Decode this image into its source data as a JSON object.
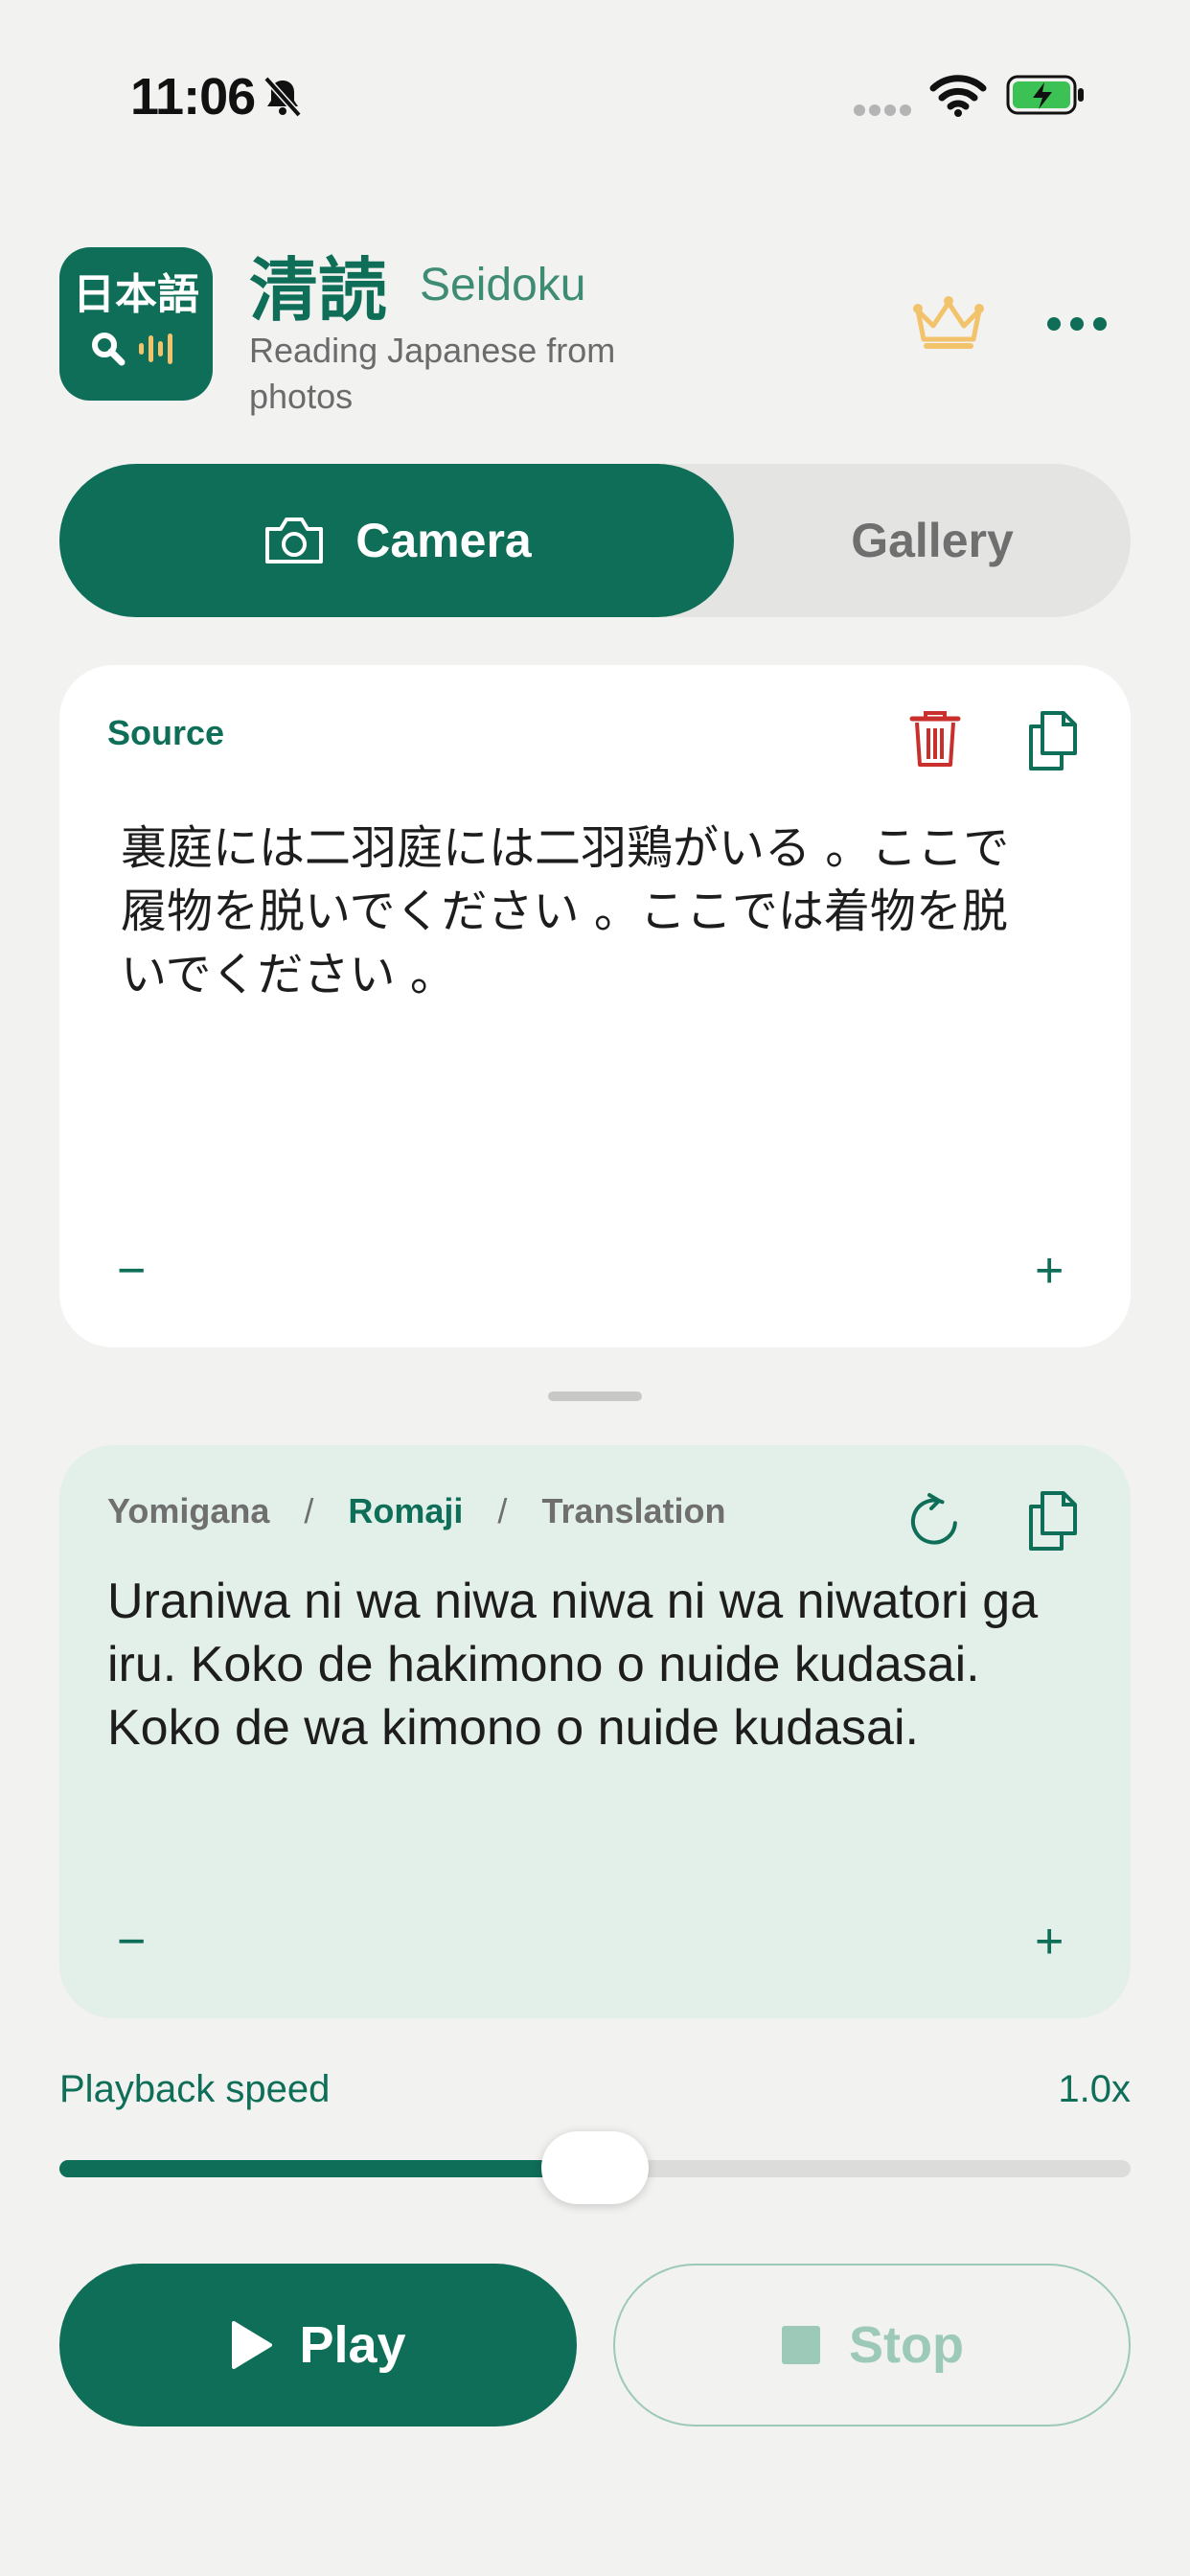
{
  "status_bar": {
    "time": "11:06"
  },
  "header": {
    "logo_text": "日本語",
    "title_kanji": "清読",
    "title_romaji": "Seidoku",
    "subtitle": "Reading Japanese from photos",
    "crown_icon": "crown-icon",
    "more_icon": "ellipsis-icon"
  },
  "segmented": {
    "camera_label": "Camera",
    "gallery_label": "Gallery",
    "selected": "Camera"
  },
  "source": {
    "label": "Source",
    "text": "裏庭には二羽庭には二羽鶏がいる 。ここで履物を脱いでください 。ここでは着物を脱いでください 。",
    "minus": "−",
    "plus": "+"
  },
  "output": {
    "tabs": [
      "Yomigana",
      "Romaji",
      "Translation"
    ],
    "separator": "/",
    "active_tab": "Romaji",
    "text": "Uraniwa ni wa niwa niwa ni wa niwatori ga iru. Koko de hakimono o nuide kudasai. Koko de wa kimono o nuide kudasai.",
    "minus": "−",
    "plus": "+"
  },
  "playback": {
    "label": "Playback speed",
    "value": "1.0x",
    "slider_fraction": 0.5
  },
  "controls": {
    "play_label": "Play",
    "stop_label": "Stop"
  },
  "colors": {
    "accent": "#0F6E57",
    "background": "#F2F2F1",
    "output_card": "#E3EFE9",
    "crown": "#F2C36B",
    "trash": "#C9302C",
    "stop_disabled": "#9CC9B8"
  }
}
